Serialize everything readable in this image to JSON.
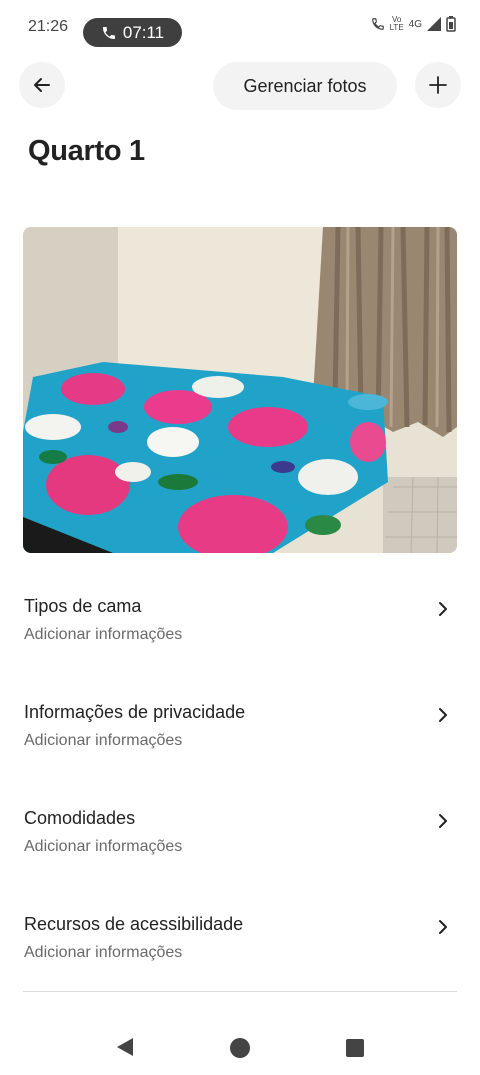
{
  "status_bar": {
    "time": "21:26",
    "call_timer": "07:11",
    "network_top": "Vo",
    "network_bottom": "LTE",
    "network_type": "4G"
  },
  "top_bar": {
    "manage_photos_label": "Gerenciar fotos"
  },
  "page": {
    "title": "Quarto 1"
  },
  "info_rows": [
    {
      "title": "Tipos de cama",
      "subtitle": "Adicionar informações"
    },
    {
      "title": "Informações de privacidade",
      "subtitle": "Adicionar informações"
    },
    {
      "title": "Comodidades",
      "subtitle": "Adicionar informações"
    },
    {
      "title": "Recursos de acessibilidade",
      "subtitle": "Adicionar informações"
    }
  ],
  "icons": {
    "back": "arrow-left-icon",
    "add": "plus-icon",
    "row_chevron": "chevron-right-icon",
    "call": "phone-icon"
  }
}
